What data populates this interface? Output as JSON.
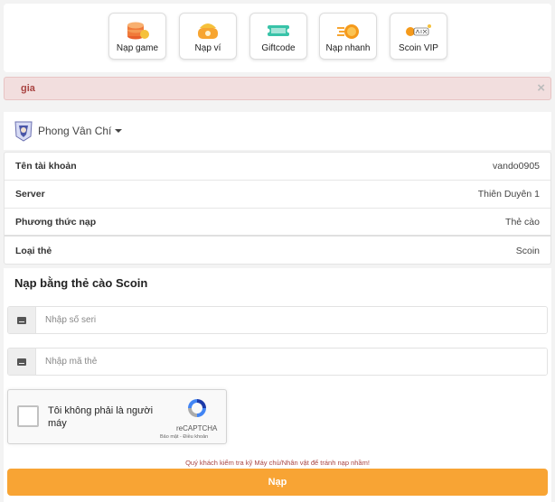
{
  "nav": {
    "items": [
      {
        "label": "Nạp game",
        "icon": "coins-icon"
      },
      {
        "label": "Nạp ví",
        "icon": "wallet-icon"
      },
      {
        "label": "Giftcode",
        "icon": "ticket-icon"
      },
      {
        "label": "Nạp nhanh",
        "icon": "fast-coin-icon"
      },
      {
        "label": "Scoin VIP",
        "icon": "scoin-vip-icon"
      }
    ]
  },
  "alert": {
    "text": "gia",
    "close_label": "×"
  },
  "character": {
    "name": "Phong Vân Chí"
  },
  "info": {
    "rows": [
      {
        "key": "Tên tài khoản",
        "value": "vando0905"
      },
      {
        "key": "Server",
        "value": "Thiên Duyên 1"
      },
      {
        "key": "Phương thức nạp",
        "value": "Thẻ cào"
      },
      {
        "key": "Loại thẻ",
        "value": "Scoin"
      }
    ]
  },
  "form": {
    "title": "Nạp bằng thẻ cào Scoin",
    "serial_placeholder": "Nhập số seri",
    "code_placeholder": "Nhập mã thẻ",
    "recaptcha_text": "Tôi không phải là người máy",
    "recaptcha_brand": "reCAPTCHA",
    "recaptcha_links": "Bảo mật - Điều khoản",
    "warning": "Quý khách kiểm tra kỹ Máy chủ/Nhân vật để tránh nạp nhầm!",
    "submit_label": "Nạp"
  },
  "colors": {
    "accent": "#f8a434",
    "alert_bg": "#f2dede",
    "alert_text": "#a94442"
  }
}
